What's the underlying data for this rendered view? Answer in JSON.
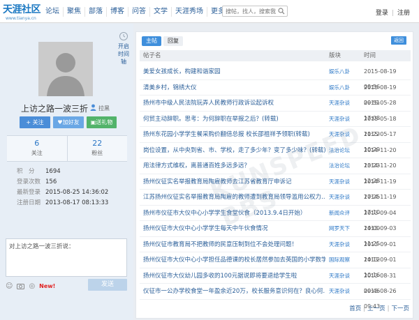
{
  "header": {
    "logo_text": "天涯社区",
    "logo_url": "www.tianya.cn",
    "nav": [
      "论坛",
      "聚焦",
      "部落",
      "博客",
      "问答",
      "文学",
      "天涯秀场",
      "更多"
    ],
    "search_placeholder": "搜帖，找人，搜索我",
    "login": "登录",
    "register": "注册"
  },
  "profile": {
    "username": "上访之路一波三折",
    "blacklist": "拉黑",
    "side_tab": "开启时间轴",
    "buttons": {
      "follow": "+ 关注",
      "add_friend": "加好友",
      "gift": "送礼物"
    },
    "stats": [
      {
        "value": "6",
        "label": "关注"
      },
      {
        "value": "22",
        "label": "粉丝"
      }
    ],
    "info": [
      {
        "key": "积　分",
        "value": "1694"
      },
      {
        "key": "登录次数",
        "value": "156"
      },
      {
        "key": "最新登录",
        "value": "2015-08-25 14:36:02"
      },
      {
        "key": "注册日期",
        "value": "2013-08-17 08:13:33"
      }
    ],
    "message_placeholder": "对上访之路一波三折说：",
    "new_badge": "New!",
    "send_label": "发送"
  },
  "main": {
    "tabs": [
      "主帖",
      "回复"
    ],
    "back_label": "返回",
    "columns": [
      "帖子名",
      "版块",
      "时间"
    ],
    "posts": [
      {
        "title": "美爱女孩成长，构建和谐家园",
        "board": "娱乐八卦",
        "date": "2015-08-19 09:56"
      },
      {
        "title": "清美乡村，锦绣大仪",
        "board": "娱乐八卦",
        "date": "2015-08-19 09:51"
      },
      {
        "title": "扬州市中级人民法院玩弄人民教师行政诉讼起诉权",
        "board": "天涯杂谈",
        "date": "2015-05-28 17:08"
      },
      {
        "title": "何贸主动辞职。思考：为何辞职在举报之后？(转载)",
        "board": "天涯杂谈",
        "date": "2015-05-18 11:22"
      },
      {
        "title": "扬州东花园小学学生餐采购价翻倍总报 校长邵祖祥予领职(转载)",
        "board": "天涯杂谈",
        "date": "2015-05-17 10:29"
      },
      {
        "title": "岗位设置，从中央到省、市、学校，走了多少年？变了多少味？(转载)",
        "board": "法治论坛",
        "date": "2014-11-20 13:23"
      },
      {
        "title": "用法律方式维权，离普通百姓多远多远？",
        "board": "法治论坛",
        "date": "2014-11-20 12:28"
      },
      {
        "title": "扬州仪征实名举报教育局陶雇教师去江苏省教育厅申诉记",
        "board": "天涯杂谈",
        "date": "2014-11-19 17:25"
      },
      {
        "title": "江苏扬州仪征实名举报教育局陶雇的教师遭到教育局领导滥用公权力…",
        "board": "天涯杂谈",
        "date": "2014-11-19 17:10"
      },
      {
        "title": "扬州市仪征市大仪中心小学学生食堂伙食（2013.9.4日开始）",
        "board": "新闻众评",
        "date": "2013-09-04 14:00"
      },
      {
        "title": "扬州仪征市大仪中心小学学生每天中午伙食情况",
        "board": "网罗天下",
        "date": "2013-09-03 11:25"
      },
      {
        "title": "扬州仪征市教育局不把教师的民意压制到位不会处理问题！",
        "board": "天涯杂谈",
        "date": "2013-09-01 14:12"
      },
      {
        "title": "扬州仪征市大仪中心小学担任品德课的校长居然参加去英国的小学数学…",
        "board": "国际观察",
        "date": "2013-09-01 10:16"
      },
      {
        "title": "扬州仪征市大仪幼儿园多收的100元据说即将要退给学生啦",
        "board": "天涯杂谈",
        "date": "2013-08-31 09:46"
      },
      {
        "title": "仪征市一公办学校食堂一年盈余近20万，校长服务意识何在？良心何…",
        "board": "天涯杂谈",
        "date": "2013-08-26 09:43"
      }
    ],
    "pager": {
      "first": "首页",
      "prev": "上一页",
      "next": "下一页"
    }
  },
  "watermark": "KUNSPEED BBS"
}
